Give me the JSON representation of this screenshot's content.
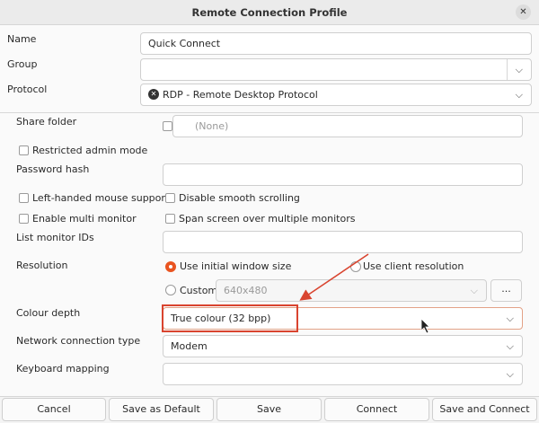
{
  "window": {
    "title": "Remote Connection Profile"
  },
  "basic": {
    "name_label": "Name",
    "name_value": "Quick Connect",
    "group_label": "Group",
    "group_value": "",
    "protocol_label": "Protocol",
    "protocol_value": "RDP - Remote Desktop Protocol"
  },
  "settings": {
    "share_folder_label": "Share folder",
    "share_folder_value": "(None)",
    "restricted_admin_label": "Restricted admin mode",
    "password_hash_label": "Password hash",
    "left_handed_label": "Left-handed mouse support",
    "disable_smooth_label": "Disable smooth scrolling",
    "multi_monitor_label": "Enable multi monitor",
    "span_screen_label": "Span screen over multiple monitors",
    "list_monitor_label": "List monitor IDs",
    "resolution_label": "Resolution",
    "res_initial_label": "Use initial window size",
    "res_client_label": "Use client resolution",
    "res_custom_label": "Custom",
    "res_custom_value": "640x480",
    "res_more_label": "...",
    "colour_depth_label": "Colour depth",
    "colour_depth_value": "True colour (32 bpp)",
    "network_type_label": "Network connection type",
    "network_type_value": "Modem",
    "keyboard_mapping_label": "Keyboard mapping",
    "keyboard_mapping_value": ""
  },
  "buttons": {
    "cancel": "Cancel",
    "save_default": "Save as Default",
    "save": "Save",
    "connect": "Connect",
    "save_connect": "Save and Connect"
  },
  "colors": {
    "accent": "#e95420",
    "annotation": "#d9442f"
  }
}
